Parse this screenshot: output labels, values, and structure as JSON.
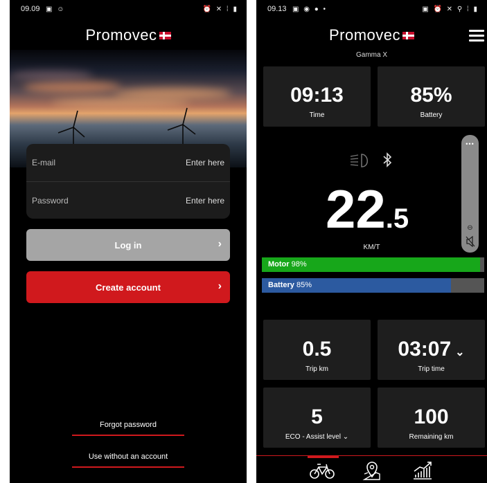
{
  "login_screen": {
    "status_time": "09.09",
    "status_icons_left": "▣ ☺",
    "status_icons_right": "⏰ ✕ ⁞ ▮",
    "brand": "Promovec",
    "email_label": "E-mail",
    "email_placeholder": "Enter here",
    "password_label": "Password",
    "password_placeholder": "Enter here",
    "login_label": "Log in",
    "create_account_label": "Create account",
    "forgot_password_label": "Forgot password",
    "without_account_label": "Use without an account"
  },
  "dashboard": {
    "status_time": "09.13",
    "status_icons_left": "▣ ◉ ● •",
    "status_icons_right": "▣ ⏰ ✕ ⚲ ⁞ ▮",
    "brand": "Promovec",
    "model": "Gamma X",
    "time_value": "09:13",
    "time_label": "Time",
    "battery_value": "85%",
    "battery_label": "Battery",
    "speed_int": "22",
    "speed_dec": ".5",
    "speed_unit": "KM/T",
    "side_more": "•••",
    "motor_label": "Motor",
    "motor_value": "98%",
    "motor_fraction": 0.98,
    "battery_bar_label": "Battery",
    "battery_bar_value": "85%",
    "battery_fraction": 0.85,
    "trip_km_value": "0.5",
    "trip_km_label": "Trip km",
    "trip_time_value": "03:07",
    "trip_time_label": "Trip time",
    "assist_value": "5",
    "assist_label": "ECO - Assist level",
    "remaining_value": "100",
    "remaining_label": "Remaining km"
  },
  "colors": {
    "accent": "#d0191d",
    "motor": "#17a71a",
    "battery": "#2c5aa0"
  },
  "icons": [
    "headlight-icon",
    "bluetooth-icon",
    "mute-icon",
    "bike-icon",
    "map-pin-icon",
    "stats-icon",
    "menu-icon"
  ]
}
